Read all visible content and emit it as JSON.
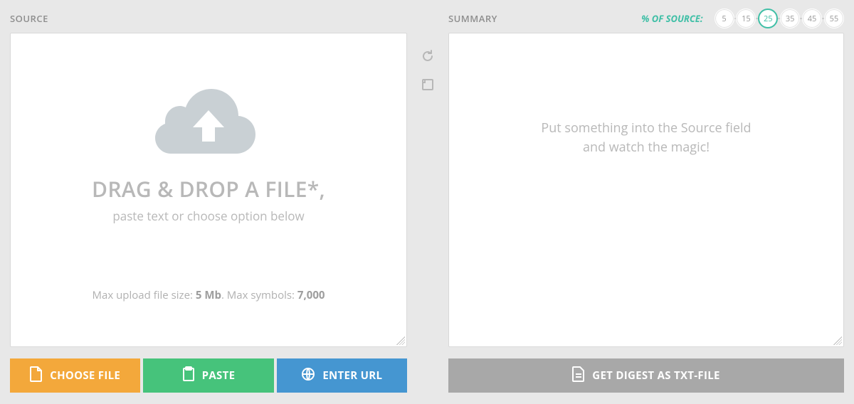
{
  "source": {
    "label": "SOURCE",
    "drop_title": "DRAG & DROP A FILE*,",
    "drop_sub": "paste text or choose option below",
    "limits_prefix": "Max upload file size: ",
    "limits_size": "5 Mb",
    "limits_mid": ". Max symbols: ",
    "limits_symbols": "7,000",
    "buttons": {
      "choose": "CHOOSE FILE",
      "paste": "PASTE",
      "url": "ENTER URL"
    }
  },
  "summary": {
    "label": "SUMMARY",
    "pct_label": "% OF SOURCE:",
    "steps": [
      "5",
      "15",
      "25",
      "35",
      "45",
      "55"
    ],
    "active_step_index": 2,
    "placeholder_line1": "Put something into the Source field",
    "placeholder_line2": "and watch the magic!",
    "download_label": "GET DIGEST AS TXT-FILE"
  },
  "tools": {
    "refresh": "refresh",
    "copy": "copy"
  }
}
